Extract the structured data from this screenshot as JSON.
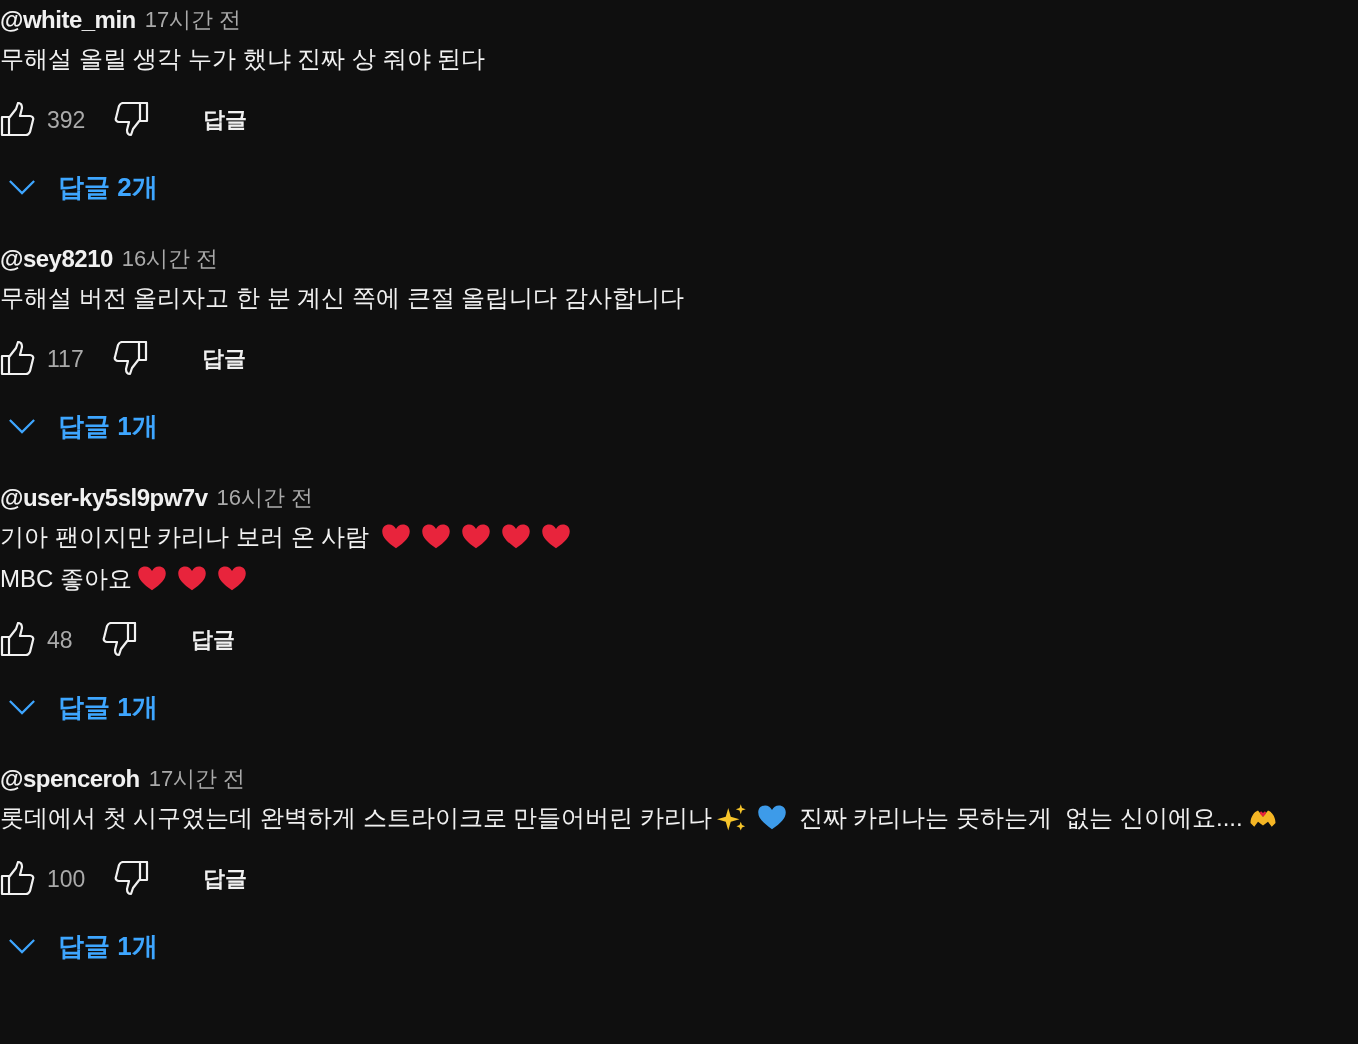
{
  "comments": [
    {
      "author": "@white_min",
      "time": "17시간 전",
      "lines": [
        [
          {
            "kind": "text",
            "text": "무해설 올릴 생각 누가 했냐 진짜 상 줘야 된다"
          }
        ]
      ],
      "likes": "392",
      "reply_button": "답글",
      "replies": "답글 2개"
    },
    {
      "author": "@sey8210",
      "time": "16시간 전",
      "lines": [
        [
          {
            "kind": "text",
            "text": "무해설 버전 올리자고 한 분 계신 쪽에 큰절 올립니다 감사합니다"
          }
        ]
      ],
      "likes": "117",
      "reply_button": "답글",
      "replies": "답글 1개"
    },
    {
      "author": "@user-ky5sl9pw7v",
      "time": "16시간 전",
      "lines": [
        [
          {
            "kind": "text",
            "text": "기아 팬이지만 카리나 보러 온 사람 "
          },
          {
            "kind": "redheart"
          },
          {
            "kind": "redheart"
          },
          {
            "kind": "redheart"
          },
          {
            "kind": "redheart"
          },
          {
            "kind": "redheart"
          }
        ],
        [
          {
            "kind": "text",
            "text": "MBC 좋아요"
          },
          {
            "kind": "redheart"
          },
          {
            "kind": "redheart"
          },
          {
            "kind": "redheart"
          }
        ]
      ],
      "likes": "48",
      "reply_button": "답글",
      "replies": "답글 1개"
    },
    {
      "author": "@spenceroh",
      "time": "17시간 전",
      "lines": [
        [
          {
            "kind": "text",
            "text": "롯데에서 첫 시구였는데 완벽하게 스트라이크로 만들어버린 카리나"
          },
          {
            "kind": "sparkles"
          },
          {
            "kind": "blueheart"
          },
          {
            "kind": "text",
            "text": " 진짜 카리나는 못하는게  없는 신이에요...."
          },
          {
            "kind": "hearthands"
          }
        ]
      ],
      "likes": "100",
      "reply_button": "답글",
      "replies": "답글 1개"
    }
  ]
}
